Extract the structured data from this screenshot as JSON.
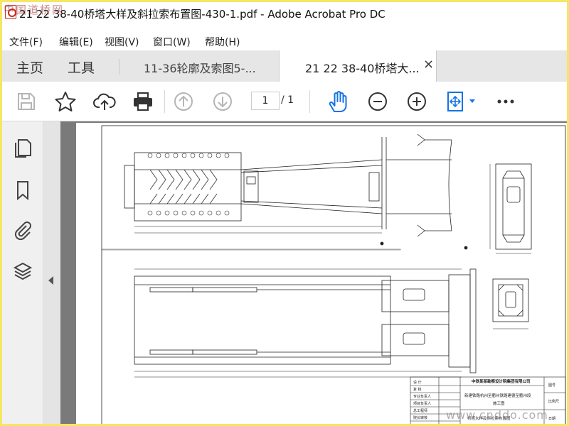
{
  "window": {
    "title": "21 22 38-40桥塔大样及斜拉索布置图-430-1.pdf - Adobe Acrobat Pro DC",
    "watermark_top": "中国道桥网",
    "watermark_bottom": "www.cnddo.com"
  },
  "menu": [
    {
      "label": "文件(F)"
    },
    {
      "label": "编辑(E)"
    },
    {
      "label": "视图(V)"
    },
    {
      "label": "窗口(W)"
    },
    {
      "label": "帮助(H)"
    }
  ],
  "tabs": {
    "home": "主页",
    "tools": "工具",
    "doc1": "11-36轮廓及索图5-...",
    "doc2": "21 22 38-40桥塔大...",
    "close": "×"
  },
  "toolbar": {
    "icons": [
      "save-icon",
      "star-icon",
      "cloud-upload-icon",
      "print-icon",
      "page-up-icon",
      "page-down-icon",
      "hand-tool-icon",
      "zoom-out-icon",
      "zoom-in-icon",
      "fit-page-icon",
      "more-icon"
    ],
    "page_current": "1",
    "page_total": "/ 1",
    "accent_color": "#1473e6"
  },
  "sidebar": {
    "icons": [
      "pages-icon",
      "bookmark-icon",
      "attachment-icon",
      "layers-icon"
    ]
  },
  "title_block": {
    "rows_left": [
      "设  计",
      "复  核",
      "专业负责人",
      "项目负责人",
      "总工程师",
      "院长审核"
    ],
    "company": "中铁某某勘察设计院集团有限公司",
    "project": "新建铁路杭州至衢州铁路建德至衢州段",
    "stage": "施工图",
    "drawing_title": "桥塔大样及斜拉索布置图",
    "labels_right": [
      "图号",
      "比例尺",
      "日期"
    ]
  }
}
